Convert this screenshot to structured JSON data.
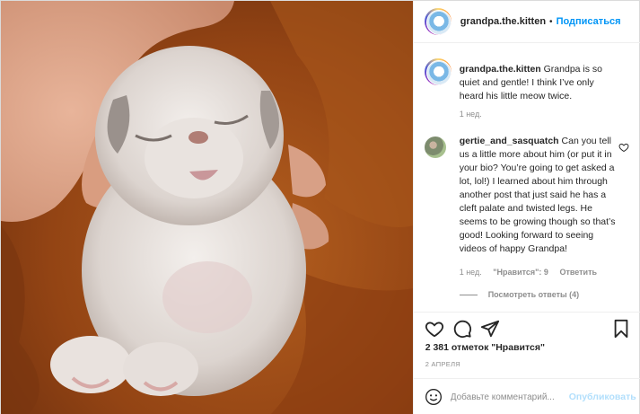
{
  "header": {
    "username": "grandpa.the.kitten",
    "separator": "•",
    "follow_label": "Подписаться"
  },
  "caption": {
    "username": "grandpa.the.kitten",
    "text": "Grandpa is so quiet and gentle! I think I’ve only heard his little meow twice.",
    "time": "1 нед."
  },
  "comment": {
    "username": "gertie_and_sasquatch",
    "text": "Can you tell us a little more about him (or put it in your bio? You’re going to get asked a lot, lol!) I learned about him through another post that just said he has a cleft palate and twisted legs. He seems to be growing though so that’s good! Looking forward to seeing videos of happy Grandpa!",
    "time": "1 нед.",
    "likes": "\"Нравится\": 9",
    "reply_label": "Ответить",
    "view_replies": "Посмотреть ответы (4)"
  },
  "post": {
    "likes_text": "2 381 отметок \"Нравится\"",
    "date": "2 АПРЕЛЯ"
  },
  "add_comment": {
    "placeholder": "Добавьте комментарий...",
    "publish_label": "Опубликовать"
  },
  "icons": {
    "like": "heart-icon",
    "comment": "comment-icon",
    "share": "share-icon",
    "save": "bookmark-icon",
    "emoji": "emoji-icon",
    "comment_like": "heart-icon"
  },
  "colors": {
    "link_blue": "#0095f6",
    "publish_disabled": "#b2dffc",
    "muted_text": "#8e8e8e"
  }
}
